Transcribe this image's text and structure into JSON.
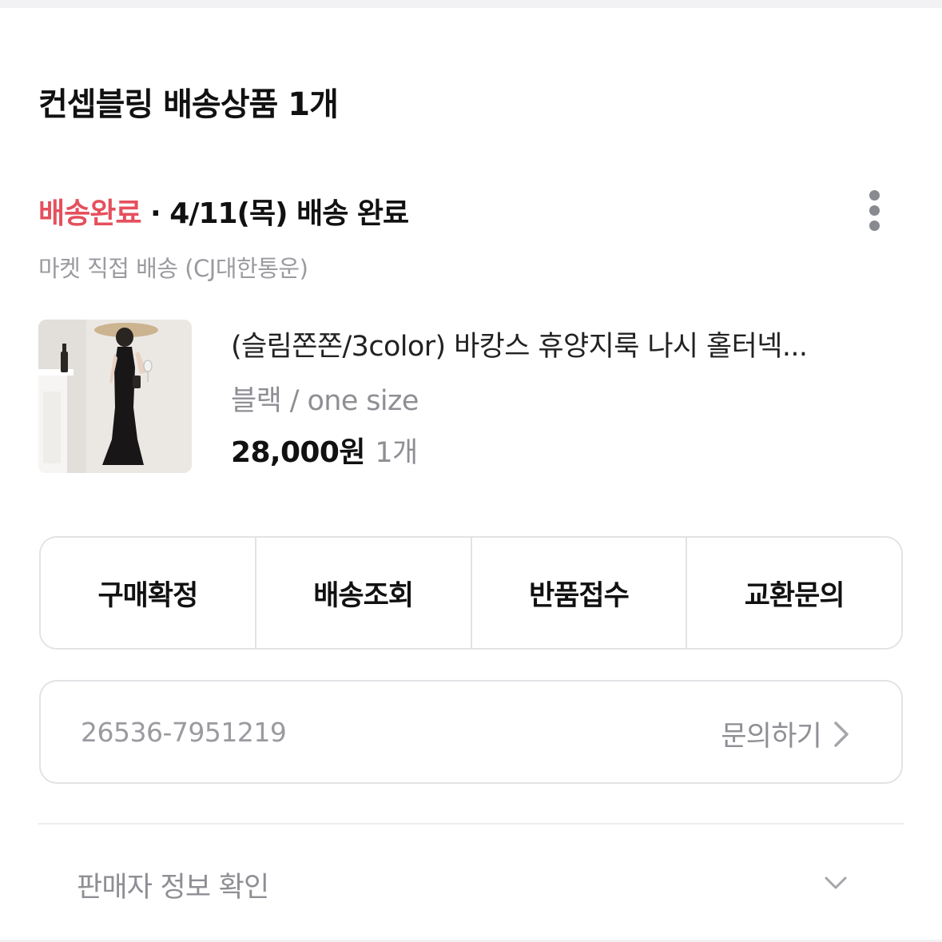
{
  "header": {
    "title": "컨셉블링 배송상품 1개"
  },
  "shipment": {
    "status": "배송완료",
    "separator": "·",
    "detail": "4/11(목) 배송 완료",
    "carrier": "마켓 직접 배송 (CJ대한통운)",
    "more_icon": "more-vertical-icon"
  },
  "product": {
    "name": "(슬림쫀쫀/3color) 바캉스 휴양지룩 나시 홀터넥...",
    "option": "블랙 / one size",
    "price": "28,000원",
    "quantity": "1개"
  },
  "actions": [
    {
      "label": "구매확정"
    },
    {
      "label": "배송조회"
    },
    {
      "label": "반품접수"
    },
    {
      "label": "교환문의"
    }
  ],
  "order": {
    "number": "26536-7951219",
    "inquiry_label": "문의하기",
    "inquiry_icon": "chevron-right-icon"
  },
  "seller_info": {
    "label": "판매자 정보 확인",
    "toggle_icon": "chevron-down-icon"
  },
  "colors": {
    "status_accent": "#e5505c",
    "muted_text": "#8e8e94",
    "border": "#e3e3e6"
  }
}
